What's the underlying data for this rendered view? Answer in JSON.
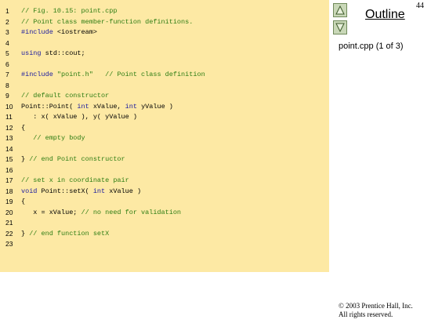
{
  "slide": {
    "page_number": "44",
    "outline_label": "Outline",
    "file_caption": "point.cpp (1 of 3)",
    "copyright_line1": "© 2003 Prentice Hall, Inc.",
    "copyright_line2": "All rights reserved."
  },
  "nav": {
    "up_icon": "triangle-up-icon",
    "down_icon": "triangle-down-icon"
  },
  "colors": {
    "panel_bg": "#fde9a4",
    "comment": "#2e7d14",
    "keyword": "#1a1aa0"
  },
  "code": [
    {
      "n": "1",
      "tokens": [
        {
          "t": "// Fig. 10.15: point.cpp",
          "c": "comment"
        }
      ]
    },
    {
      "n": "2",
      "tokens": [
        {
          "t": "// Point class member-function definitions.",
          "c": "comment"
        }
      ]
    },
    {
      "n": "3",
      "tokens": [
        {
          "t": "#include",
          "c": "kw"
        },
        {
          "t": " <iostream>",
          "c": "plain"
        }
      ]
    },
    {
      "n": "4",
      "tokens": []
    },
    {
      "n": "5",
      "tokens": [
        {
          "t": "using",
          "c": "kw"
        },
        {
          "t": " std::cout;",
          "c": "plain"
        }
      ]
    },
    {
      "n": "6",
      "tokens": []
    },
    {
      "n": "7",
      "tokens": [
        {
          "t": "#include",
          "c": "kw"
        },
        {
          "t": " ",
          "c": "plain"
        },
        {
          "t": "\"point.h\"",
          "c": "str"
        },
        {
          "t": "   // Point class definition",
          "c": "comment"
        }
      ]
    },
    {
      "n": "8",
      "tokens": []
    },
    {
      "n": "9",
      "tokens": [
        {
          "t": "// default constructor",
          "c": "comment"
        }
      ]
    },
    {
      "n": "10",
      "tokens": [
        {
          "t": "Point::Point( ",
          "c": "plain"
        },
        {
          "t": "int",
          "c": "kw"
        },
        {
          "t": " xValue, ",
          "c": "plain"
        },
        {
          "t": "int",
          "c": "kw"
        },
        {
          "t": " yValue )",
          "c": "plain"
        }
      ]
    },
    {
      "n": "11",
      "tokens": [
        {
          "t": "   : x( xValue ), y( yValue )",
          "c": "plain"
        }
      ]
    },
    {
      "n": "12",
      "tokens": [
        {
          "t": "{",
          "c": "plain"
        }
      ]
    },
    {
      "n": "13",
      "tokens": [
        {
          "t": "   // empty body",
          "c": "comment"
        }
      ]
    },
    {
      "n": "14",
      "tokens": []
    },
    {
      "n": "15",
      "tokens": [
        {
          "t": "} ",
          "c": "plain"
        },
        {
          "t": "// end Point constructor",
          "c": "comment"
        }
      ]
    },
    {
      "n": "16",
      "tokens": []
    },
    {
      "n": "17",
      "tokens": [
        {
          "t": "// set x in coordinate pair",
          "c": "comment"
        }
      ]
    },
    {
      "n": "18",
      "tokens": [
        {
          "t": "void",
          "c": "kw"
        },
        {
          "t": " Point::setX( ",
          "c": "plain"
        },
        {
          "t": "int",
          "c": "kw"
        },
        {
          "t": " xValue )",
          "c": "plain"
        }
      ]
    },
    {
      "n": "19",
      "tokens": [
        {
          "t": "{",
          "c": "plain"
        }
      ]
    },
    {
      "n": "20",
      "tokens": [
        {
          "t": "   x = xValue; ",
          "c": "plain"
        },
        {
          "t": "// no need for validation",
          "c": "comment"
        }
      ]
    },
    {
      "n": "21",
      "tokens": []
    },
    {
      "n": "22",
      "tokens": [
        {
          "t": "} ",
          "c": "plain"
        },
        {
          "t": "// end function setX",
          "c": "comment"
        }
      ]
    },
    {
      "n": "23",
      "tokens": []
    }
  ]
}
